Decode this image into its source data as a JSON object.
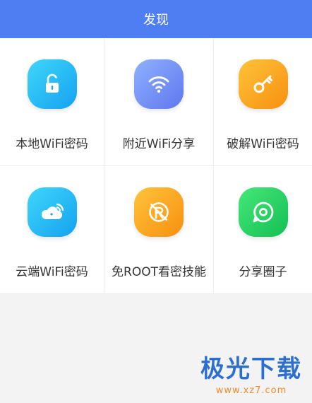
{
  "header": {
    "title": "发现"
  },
  "features": [
    {
      "label": "本地WiFi密码",
      "icon": "unlock-icon",
      "color": "#1fb2f3"
    },
    {
      "label": "附近WiFi分享",
      "icon": "wifi-icon",
      "color": "#6f8bf3"
    },
    {
      "label": "破解WiFi密码",
      "icon": "key-icon",
      "color": "#fb9d1d"
    },
    {
      "label": "云端WiFi密码",
      "icon": "cloud-wifi-icon",
      "color": "#1fb2f3"
    },
    {
      "label": "免ROOT看密技能",
      "icon": "no-root-icon",
      "color": "#fb9d1d"
    },
    {
      "label": "分享圈子",
      "icon": "chat-circle-icon",
      "color": "#22cc5f"
    }
  ],
  "watermark": {
    "title": "极光下载",
    "url": "www.xz7.com"
  }
}
